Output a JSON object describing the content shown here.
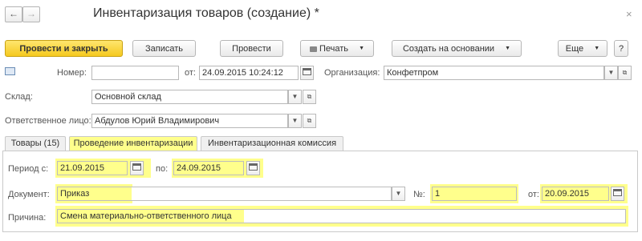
{
  "window": {
    "title": "Инвентаризация товаров (создание) *",
    "back_icon": "arrow-left",
    "forward_icon": "arrow-right",
    "close_icon": "close"
  },
  "toolbar": {
    "post_close_label": "Провести и закрыть",
    "save_label": "Записать",
    "post_label": "Провести",
    "print_label": "Печать",
    "create_based_label": "Создать на основании",
    "more_label": "Еще",
    "help_label": "?"
  },
  "header": {
    "number_label": "Номер:",
    "number_value": "",
    "date_label": "от:",
    "date_value": "24.09.2015 10:24:12",
    "org_label": "Организация:",
    "org_value": "Конфетпром",
    "warehouse_label": "Склад:",
    "warehouse_value": "Основной склад",
    "responsible_label": "Ответственное лицо:",
    "responsible_value": "Абдулов Юрий Владимирович"
  },
  "tabs": [
    {
      "label": "Товары (15)"
    },
    {
      "label": "Проведение инвентаризации"
    },
    {
      "label": "Инвентаризационная комиссия"
    }
  ],
  "inventory": {
    "period_label": "Период с:",
    "period_from": "21.09.2015",
    "period_to_label": "по:",
    "period_to": "24.09.2015",
    "document_label": "Документ:",
    "document_value": "Приказ",
    "doc_number_label": "№:",
    "doc_number_value": "1",
    "doc_date_label": "от:",
    "doc_date_value": "20.09.2015",
    "reason_label": "Причина:",
    "reason_value": "Смена материально-ответственного лица"
  },
  "colors": {
    "highlight": "#ffff8c",
    "primary_button": "#f5c91f"
  }
}
